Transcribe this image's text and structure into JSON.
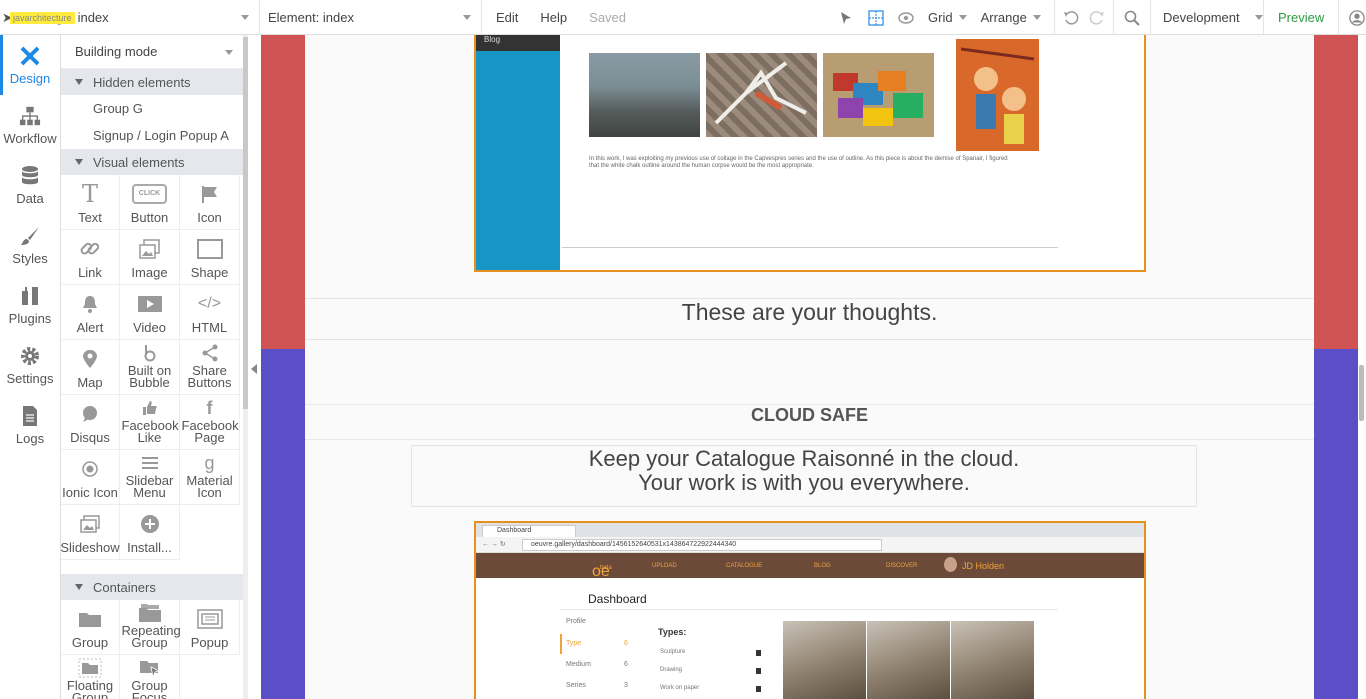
{
  "topbar": {
    "user_tag": "javarchitecture",
    "page_label": "Page: index",
    "element_label": "Element: index",
    "menu": [
      "Edit",
      "Help"
    ],
    "saved_label": "Saved",
    "grid_label": "Grid",
    "arrange_label": "Arrange",
    "environment_label": "Development",
    "preview_label": "Preview",
    "accent_color": "#2e9b3f"
  },
  "leftnav": {
    "items": [
      {
        "label": "Design",
        "icon": "design-icon",
        "active": true
      },
      {
        "label": "Workflow",
        "icon": "workflow-icon"
      },
      {
        "label": "Data",
        "icon": "database-icon"
      },
      {
        "label": "Styles",
        "icon": "brush-icon"
      },
      {
        "label": "Plugins",
        "icon": "plugin-icon"
      },
      {
        "label": "Settings",
        "icon": "gear-icon"
      },
      {
        "label": "Logs",
        "icon": "document-icon"
      }
    ],
    "active_color": "#1e88e5"
  },
  "palette": {
    "mode": "Building mode",
    "hidden_section": "Hidden elements",
    "hidden_items": [
      "Group G",
      "Signup / Login Popup A"
    ],
    "visual_section": "Visual elements",
    "visual_items": [
      {
        "label": "Text",
        "icon": "text-icon"
      },
      {
        "label": "Button",
        "icon": "button-icon"
      },
      {
        "label": "Icon",
        "icon": "flag-icon"
      },
      {
        "label": "Link",
        "icon": "link-icon"
      },
      {
        "label": "Image",
        "icon": "image-icon"
      },
      {
        "label": "Shape",
        "icon": "shape-icon"
      },
      {
        "label": "Alert",
        "icon": "bell-icon"
      },
      {
        "label": "Video",
        "icon": "video-icon"
      },
      {
        "label": "HTML",
        "icon": "code-icon"
      },
      {
        "label": "Map",
        "icon": "map-pin-icon"
      },
      {
        "label": "Built on Bubble",
        "icon": "bubble-icon"
      },
      {
        "label": "Share Buttons",
        "icon": "share-icon"
      },
      {
        "label": "Disqus",
        "icon": "chat-icon"
      },
      {
        "label": "Facebook Like",
        "icon": "thumbs-up-icon"
      },
      {
        "label": "Facebook Page",
        "icon": "facebook-icon"
      },
      {
        "label": "Ionic Icon",
        "icon": "ionic-icon"
      },
      {
        "label": "Slidebar Menu",
        "icon": "menu-icon"
      },
      {
        "label": "Material Icon",
        "icon": "material-icon"
      },
      {
        "label": "Slideshow",
        "icon": "slideshow-icon"
      },
      {
        "label": "Install...",
        "icon": "plus-circle-icon"
      }
    ],
    "containers_section": "Containers",
    "container_items": [
      {
        "label": "Group",
        "icon": "folder-icon"
      },
      {
        "label": "Repeating Group",
        "icon": "repeating-group-icon"
      },
      {
        "label": "Popup",
        "icon": "popup-icon"
      },
      {
        "label": "Floating Group",
        "icon": "floating-group-icon"
      },
      {
        "label": "Group Focus",
        "icon": "group-focus-icon"
      }
    ]
  },
  "canvas": {
    "shot1_blog": "Blog",
    "shot1_caption": "In this work, I was exploiting my previous use of collage in the Capvespres series and the use of outline. As this piece is about the demise of Spanair, I figured that the white chalk outline around the human corpse would be the most appropriate.",
    "thoughts": "These are your thoughts.",
    "cloud_heading": "CLOUD SAFE",
    "keep_line1": "Keep your Catalogue Raisonné in the cloud.",
    "keep_line2": "Your work is with you everywhere.",
    "band_colors": {
      "top": "#cf5353",
      "bottom": "#5a4fc7"
    },
    "shot2": {
      "tab_title": "Dashboard",
      "url": "oeuvre.gallery/dashboard/1456152640531x143864722922444340",
      "logo": "oe",
      "logo_sub": "beta",
      "nav": [
        "UPLOAD",
        "CATALOGUE",
        "BLOG",
        "DISCOVER"
      ],
      "user": "JD Holden",
      "title": "Dashboard",
      "side": [
        {
          "label": "Profile",
          "num": ""
        },
        {
          "label": "Type",
          "num": "6"
        },
        {
          "label": "Medium",
          "num": "6"
        },
        {
          "label": "Series",
          "num": "3"
        }
      ],
      "types_heading": "Types:",
      "types": [
        "Sculpture",
        "Drawing",
        "Work on paper"
      ]
    }
  }
}
